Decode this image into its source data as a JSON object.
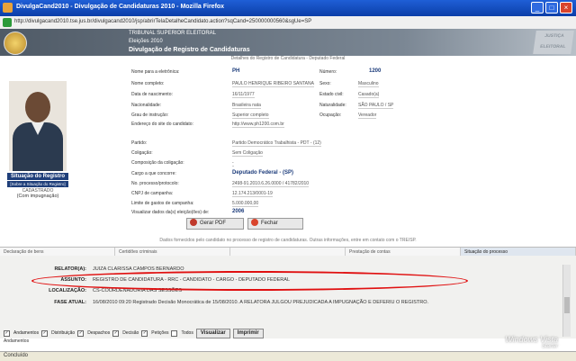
{
  "window": {
    "title": "DivulgaCand2010 - Divulgação de Candidaturas 2010 - Mozilla Firefox",
    "url": "http://divulgacand2010.tse.jus.br/divulgacand2010/jsp/abrirTelaDetalheCandidato.action?sqCand=250000000560&sgUe=SP",
    "status": "Concluído"
  },
  "header": {
    "line1": "TRIBUNAL SUPERIOR ELEITORAL",
    "line2": "Eleições 2010",
    "line3": "Divulgação de Registro de Candidaturas",
    "badge": "JUSTIÇA ELEITORAL"
  },
  "subtitle": "Detalhes do Registro de Candidatura - Deputado Federal",
  "situacao": {
    "title": "Situação do Registro",
    "link": "[Sobre a Situação do Registro]",
    "value": "CADASTRADO",
    "sub": "(Com impugnação)"
  },
  "fields": {
    "nome_urna_label": "Nome para a eletrônica:",
    "nome_urna": "PH",
    "numero_label": "Número:",
    "numero": "1200",
    "nome_completo_label": "Nome completo:",
    "nome_completo": "PAULO HENRIQUE RIBEIRO SANTANA",
    "sexo_label": "Sexo:",
    "sexo": "Masculino",
    "nascimento_label": "Data de nascimento:",
    "nascimento": "16/11/1977",
    "estado_civil_label": "Estado civil:",
    "estado_civil": "Casado(a)",
    "nacionalidade_label": "Nacionalidade:",
    "nacionalidade": "Brasileira nata",
    "naturalidade_label": "Naturalidade:",
    "naturalidade": "SÃO PAULO / SP",
    "instrucao_label": "Grau de instrução:",
    "instrucao": "Superior completo",
    "ocupacao_label": "Ocupação:",
    "ocupacao": "Vereador",
    "site_label": "Endereço do site do candidato:",
    "site": "http://www.ph1200.com.br",
    "partido_label": "Partido:",
    "partido": "Partido Democrático Trabalhista - PDT - (12)",
    "coligacao_label": "Coligação:",
    "coligacao": "Sem Coligação",
    "composicao_label": "Composição da coligação:",
    "composicao": "-",
    "cargo_label": "Cargo a que concorre:",
    "cargo": "Deputado Federal - (SP)",
    "processo_label": "No. processo/protocolo:",
    "processo": "2498-91.2010.6.26.0000 / 41782/2010",
    "cnpj_label": "CNPJ de campanha:",
    "cnpj": "12.174.213/0001-19",
    "limite_label": "Limite de gastos de campanha:",
    "limite": "5.000.000,00",
    "eleicoes_label": "Visualizar dados da(s) eleição(ões) de:",
    "eleicoes": "2006"
  },
  "buttons": {
    "pdf": "Gerar PDF",
    "fechar": "Fechar"
  },
  "note": "Dados fornecidos pelo candidato no processo de registro de candidaturas. Outras informações, entre em contato com o TRE/SP.",
  "tabs": [
    "Declaração de bens",
    "Certidões criminais",
    "",
    "Prestação de contas",
    "Situação do processo"
  ],
  "processo": {
    "relator_label": "RELATOR(A):",
    "relator": "JUIZA CLARISSA CAMPOS BERNARDO",
    "assunto_label": "ASSUNTO:",
    "assunto": "REGISTRO DE CANDIDATURA - RRC - CANDIDATO - CARGO - DEPUTADO FEDERAL",
    "localizacao_label": "LOCALIZAÇÃO:",
    "localizacao": "CS-COORDENADORIA DAS SESSÕES",
    "fase_label": "FASE ATUAL:",
    "fase": "16/08/2010 09:20 Registrado Decisão Monocrática de 15/08/2010. A RELATORA JULGOU PREJUDICADA A IMPUGNAÇÃO E DEFERIU O REGISTRO."
  },
  "filters": {
    "andamentos": "Andamentos",
    "distribuicao": "Distribuição",
    "despachos": "Despachos",
    "decisao": "Decisão",
    "peticoes": "Petições",
    "todos": "Todos",
    "visualizar": "Visualizar",
    "imprimir": "Imprimir",
    "footer": "Andamentos"
  },
  "watermark": {
    "line1": "Windows Vista",
    "line2": "Starter"
  },
  "colors": {
    "highlight": "#e01010",
    "header_blue": "#1f3f7a"
  }
}
